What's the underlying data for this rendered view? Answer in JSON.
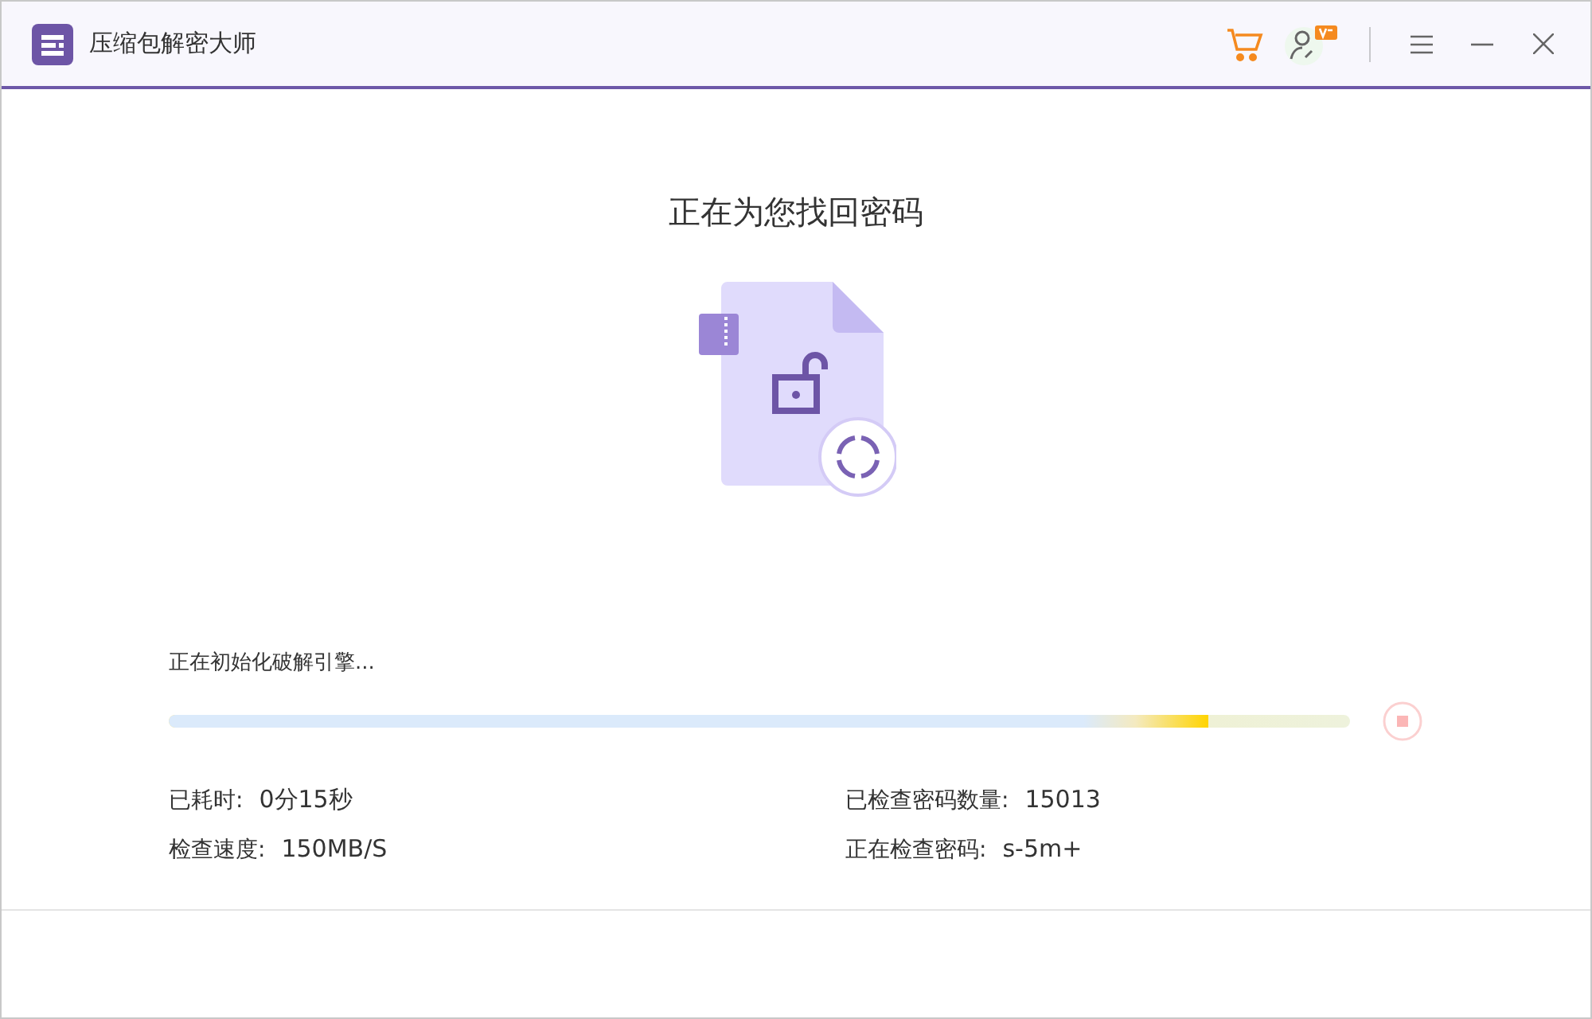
{
  "window": {
    "title": "压缩包解密大师"
  },
  "heading": "正在为您找回密码",
  "status": "正在初始化破解引擎...",
  "progress": {
    "level": 0.88
  },
  "stats": [
    {
      "label": "已耗时:",
      "value": "0分15秒"
    },
    {
      "label": "已检查密码数量:",
      "value": "15013"
    },
    {
      "label": "检查速度:",
      "value": "150MB/S"
    },
    {
      "label": "正在检查密码:",
      "value": "s-5m+"
    }
  ]
}
